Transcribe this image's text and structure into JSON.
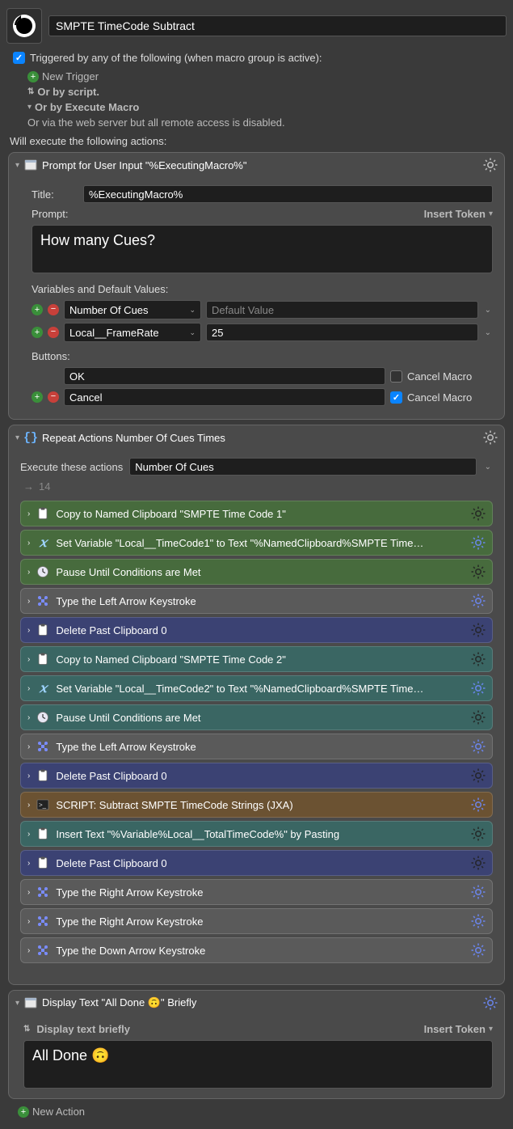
{
  "macro": {
    "title": "SMPTE TimeCode Subtract",
    "triggered_label": "Triggered by any of the following (when macro group is active):",
    "new_trigger": "New Trigger",
    "or_script": "Or by script.",
    "or_execute": "Or by Execute Macro",
    "or_web": "Or via the web server but all remote access is disabled.",
    "will_execute": "Will execute the following actions:"
  },
  "prompt_action": {
    "title": "Prompt for User Input \"%ExecutingMacro%\"",
    "title_field_label": "Title:",
    "title_value": "%ExecutingMacro%",
    "prompt_label": "Prompt:",
    "insert_token": "Insert Token",
    "prompt_value": "How many Cues?",
    "vars_label": "Variables and Default Values:",
    "vars": [
      {
        "name": "Number Of Cues",
        "default_placeholder": "Default Value",
        "default_value": ""
      },
      {
        "name": "Local__FrameRate",
        "default_placeholder": "",
        "default_value": "25"
      }
    ],
    "buttons_label": "Buttons:",
    "buttons": [
      {
        "name": "OK",
        "cancel_macro": false,
        "show_add_remove": false
      },
      {
        "name": "Cancel",
        "cancel_macro": true,
        "show_add_remove": true
      }
    ],
    "cancel_macro_label": "Cancel Macro"
  },
  "repeat_action": {
    "title": "Repeat Actions Number Of Cues Times",
    "execute_label": "Execute these actions",
    "execute_value": "Number Of Cues",
    "count": "14",
    "steps": [
      {
        "color": "c-green",
        "icon": "clipboard",
        "title": "Copy to Named Clipboard \"SMPTE Time Code 1\"",
        "gear": "dark"
      },
      {
        "color": "c-green",
        "icon": "var",
        "title": "Set Variable \"Local__TimeCode1\" to Text \"%NamedClipboard%SMPTE Time…",
        "gear": "blue"
      },
      {
        "color": "c-green",
        "icon": "clock",
        "title": "Pause Until Conditions are Met",
        "gear": "dark"
      },
      {
        "color": "c-gray",
        "icon": "cmd",
        "title": "Type the Left Arrow Keystroke",
        "gear": "blue"
      },
      {
        "color": "c-blue",
        "icon": "clipboard",
        "title": "Delete Past Clipboard 0",
        "gear": "dark"
      },
      {
        "color": "c-teal",
        "icon": "clipboard",
        "title": "Copy to Named Clipboard \"SMPTE Time Code 2\"",
        "gear": "dark"
      },
      {
        "color": "c-teal",
        "icon": "var",
        "title": "Set Variable \"Local__TimeCode2\" to Text \"%NamedClipboard%SMPTE Time…",
        "gear": "blue"
      },
      {
        "color": "c-teal",
        "icon": "clock",
        "title": "Pause Until Conditions are Met",
        "gear": "dark"
      },
      {
        "color": "c-gray",
        "icon": "cmd",
        "title": "Type the Left Arrow Keystroke",
        "gear": "blue"
      },
      {
        "color": "c-blue",
        "icon": "clipboard",
        "title": "Delete Past Clipboard 0",
        "gear": "dark"
      },
      {
        "color": "c-brown",
        "icon": "script",
        "title": "SCRIPT: Subtract SMPTE TimeCode Strings (JXA)",
        "gear": "blue"
      },
      {
        "color": "c-teal",
        "icon": "clipboard",
        "title": "Insert Text \"%Variable%Local__TotalTimeCode%\" by Pasting",
        "gear": "dark"
      },
      {
        "color": "c-blue",
        "icon": "clipboard",
        "title": "Delete Past Clipboard 0",
        "gear": "dark"
      },
      {
        "color": "c-gray",
        "icon": "cmd",
        "title": "Type the Right Arrow Keystroke",
        "gear": "blue"
      },
      {
        "color": "c-gray",
        "icon": "cmd",
        "title": "Type the Right Arrow Keystroke",
        "gear": "blue"
      },
      {
        "color": "c-gray",
        "icon": "cmd",
        "title": "Type the Down Arrow Keystroke",
        "gear": "blue"
      }
    ]
  },
  "display_action": {
    "title": "Display Text \"All Done 🙃\" Briefly",
    "sub_label": "Display text briefly",
    "insert_token": "Insert Token",
    "value": "All Done 🙃"
  },
  "new_action": "New Action"
}
